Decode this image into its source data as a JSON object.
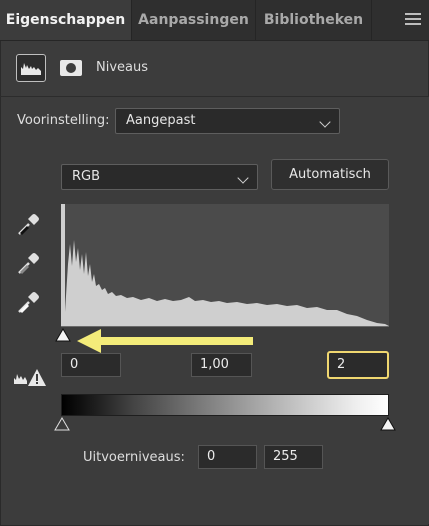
{
  "tabs": [
    {
      "label": "Eigenschappen",
      "active": true
    },
    {
      "label": "Aanpassingen",
      "active": false
    },
    {
      "label": "Bibliotheken",
      "active": false
    }
  ],
  "header": {
    "title": "Niveaus",
    "icons": [
      "levels-histogram-icon",
      "mask-icon"
    ]
  },
  "preset": {
    "label": "Voorinstelling:",
    "value": "Aangepast"
  },
  "channel": {
    "value": "RGB"
  },
  "auto_button": {
    "label": "Automatisch"
  },
  "eyedroppers": [
    "black-point-eyedropper-icon",
    "gray-point-eyedropper-icon",
    "white-point-eyedropper-icon"
  ],
  "input_levels": {
    "black": "0",
    "midtone": "1,00",
    "white": "2"
  },
  "output_levels": {
    "label": "Uitvoerniveaus:",
    "black": "0",
    "white": "255"
  },
  "colors": {
    "panel": "#3c3c3c",
    "histogram_fill": "#cfcfcf",
    "highlight": "#f0d770",
    "arrow": "#f4ec7a"
  }
}
